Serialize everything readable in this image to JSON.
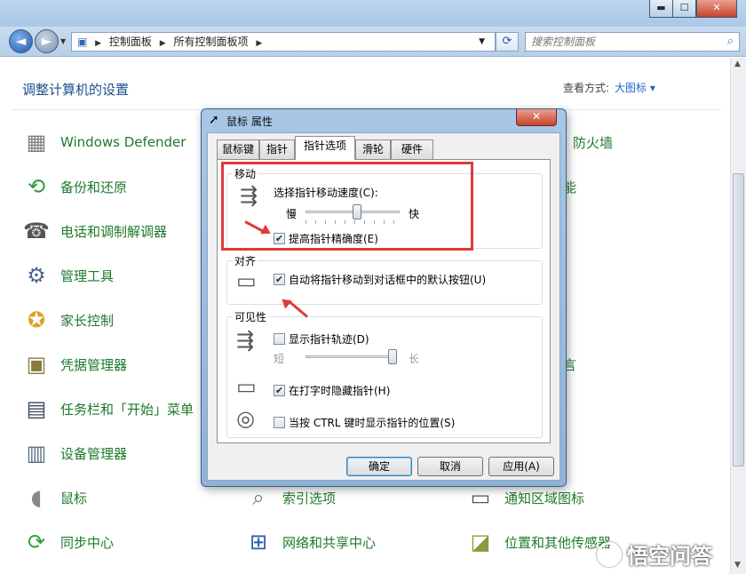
{
  "window": {
    "minimize": "▬",
    "maximize": "☐",
    "close": "✕"
  },
  "address_bar": {
    "breadcrumb": [
      "控制面板",
      "所有控制面板项"
    ],
    "search_placeholder": "搜索控制面板"
  },
  "content": {
    "heading": "调整计算机的设置",
    "view_by_label": "查看方式:",
    "view_by_value": "大图标 ▾",
    "items": [
      {
        "label": "Windows Defender",
        "icon": "wall-icon"
      },
      {
        "label": "备份和还原",
        "icon": "backup-icon"
      },
      {
        "label": "电话和调制解调器",
        "icon": "phone-modem-icon"
      },
      {
        "label": "管理工具",
        "icon": "admin-tools-icon"
      },
      {
        "label": "家长控制",
        "icon": "parental-control-icon"
      },
      {
        "label": "凭据管理器",
        "icon": "credential-manager-icon"
      },
      {
        "label": "任务栏和「开始」菜单",
        "icon": "taskbar-icon"
      },
      {
        "label": "设备管理器",
        "icon": "device-manager-icon"
      },
      {
        "label": "鼠标",
        "icon": "mouse-icon"
      },
      {
        "label": "同步中心",
        "icon": "sync-center-icon"
      },
      {
        "label": "索引选项",
        "icon": "indexing-icon"
      },
      {
        "label": "网络和共享中心",
        "icon": "network-icon"
      },
      {
        "label": "通知区域图标",
        "icon": "notification-icon"
      },
      {
        "label": "位置和其他传感器",
        "icon": "sensor-icon"
      },
      {
        "label": "防火墙",
        "icon": "firewall-icon"
      },
      {
        "label": "能",
        "icon": ""
      },
      {
        "label": "言",
        "icon": ""
      }
    ]
  },
  "watermark": "悟空问答",
  "dialog": {
    "title": "鼠标 属性",
    "close": "✕",
    "tabs": [
      "鼠标键",
      "指针",
      "指针选项",
      "滑轮",
      "硬件"
    ],
    "active_tab": "指针选项",
    "motion": {
      "title": "移动",
      "speed_label": "选择指针移动速度(C):",
      "slow": "慢",
      "fast": "快",
      "speed_fraction": 0.55,
      "precision_label": "提高指针精确度(E)",
      "precision_checked": true
    },
    "snap": {
      "title": "对齐",
      "label": "自动将指针移动到对话框中的默认按钮(U)",
      "checked": true
    },
    "visibility": {
      "title": "可见性",
      "trails_label": "显示指针轨迹(D)",
      "trails_checked": false,
      "short": "短",
      "long": "长",
      "trail_fraction": 1.0,
      "hide_typing_label": "在打字时隐藏指针(H)",
      "hide_typing_checked": true,
      "ctrl_label": "当按 CTRL 键时显示指针的位置(S)",
      "ctrl_checked": false
    },
    "buttons": {
      "ok": "确定",
      "cancel": "取消",
      "apply": "应用(A)"
    }
  },
  "colors": {
    "annotation": "#e03a3a",
    "link_green": "#1d7a2b",
    "heading_blue": "#1e4e8c"
  }
}
